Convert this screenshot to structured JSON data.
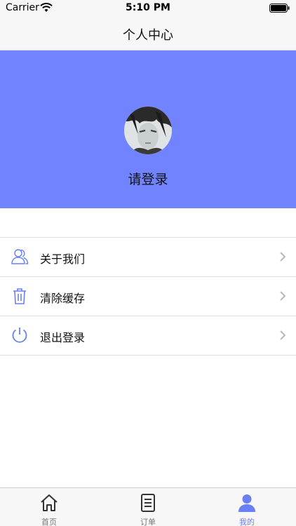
{
  "status_bar": {
    "carrier": "Carrier",
    "time": "5:10 PM",
    "wifi_icon": "wifi-icon",
    "battery_icon": "battery-icon"
  },
  "nav": {
    "title": "个人中心"
  },
  "profile": {
    "header_color": "#7183ff",
    "avatar_icon": "avatar-image",
    "login_prompt": "请登录"
  },
  "menu": {
    "items": [
      {
        "label": "关于我们",
        "icon": "users-icon",
        "chevron": "chevron-right-icon"
      },
      {
        "label": "清除缓存",
        "icon": "trash-icon",
        "chevron": "chevron-right-icon"
      },
      {
        "label": "退出登录",
        "icon": "power-icon",
        "chevron": "chevron-right-icon"
      }
    ],
    "icon_color": "#6a7ff5"
  },
  "tab_bar": {
    "tabs": [
      {
        "label": "首页",
        "icon": "home-icon",
        "active": false
      },
      {
        "label": "订单",
        "icon": "document-icon",
        "active": false
      },
      {
        "label": "我的",
        "icon": "user-icon",
        "active": true
      }
    ],
    "active_color": "#6a7ff5",
    "inactive_color": "#777777"
  }
}
